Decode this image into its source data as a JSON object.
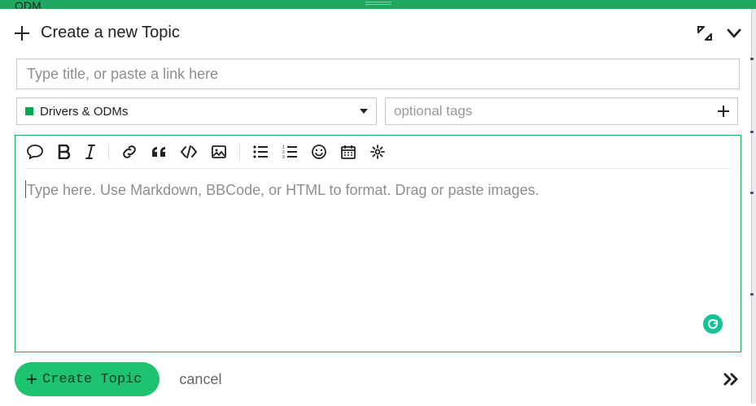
{
  "header": {
    "peek_text": "ODM",
    "title": "Create a new Topic"
  },
  "inputs": {
    "title_placeholder": "Type title, or paste a link here",
    "category_label": "Drivers & ODMs",
    "tags_placeholder": "optional tags",
    "editor_placeholder": "Type here. Use Markdown, BBCode, or HTML to format. Drag or paste images."
  },
  "footer": {
    "create_label": "Create Topic",
    "cancel_label": "cancel"
  },
  "colors": {
    "accent": "#1ea862",
    "category_swatch": "#00a94f",
    "button": "#1ec36f"
  }
}
